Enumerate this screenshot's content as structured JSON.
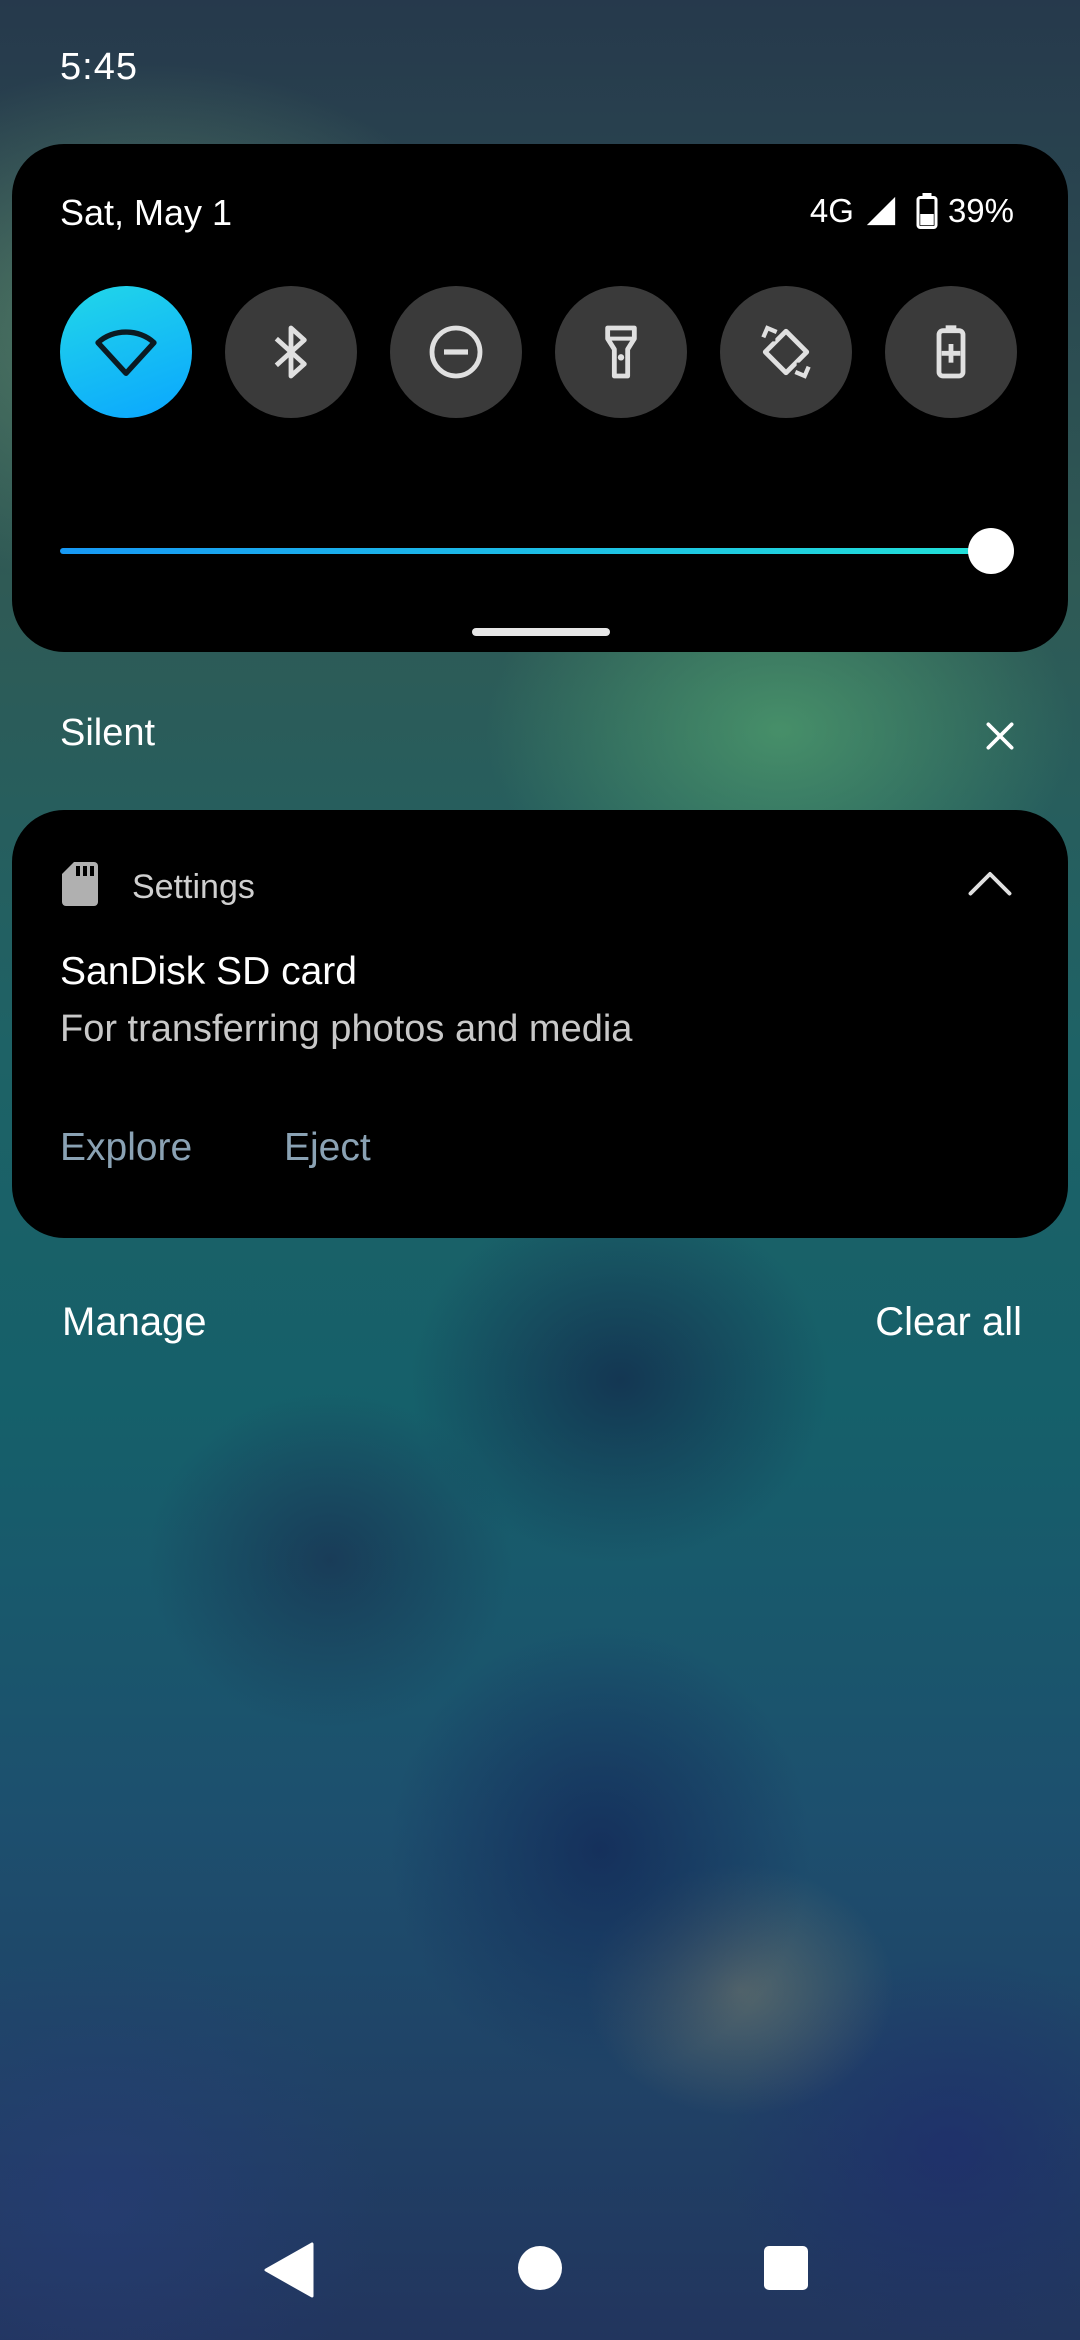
{
  "status_bar": {
    "time": "5:45"
  },
  "quick_settings": {
    "date": "Sat, May 1",
    "network": "4G",
    "battery": "39%",
    "tiles": [
      {
        "icon": "wifi-icon",
        "active": true
      },
      {
        "icon": "bluetooth-icon",
        "active": false
      },
      {
        "icon": "do-not-disturb-icon",
        "active": false
      },
      {
        "icon": "flashlight-icon",
        "active": false
      },
      {
        "icon": "auto-rotate-icon",
        "active": false
      },
      {
        "icon": "battery-saver-icon",
        "active": false
      }
    ],
    "brightness_level": 0.97,
    "colors": {
      "accent_start": "#1799f5",
      "accent_end": "#22e0d8"
    }
  },
  "notification_section": {
    "title": "Silent"
  },
  "notification": {
    "app_name": "Settings",
    "app_icon": "sd-card-icon",
    "title": "SanDisk SD card",
    "text": "For transferring photos and media",
    "actions": [
      "Explore",
      "Eject"
    ]
  },
  "footer": {
    "manage": "Manage",
    "clear_all": "Clear all"
  },
  "navigation": {
    "back": "back-icon",
    "home": "home-icon",
    "recents": "recents-icon"
  }
}
